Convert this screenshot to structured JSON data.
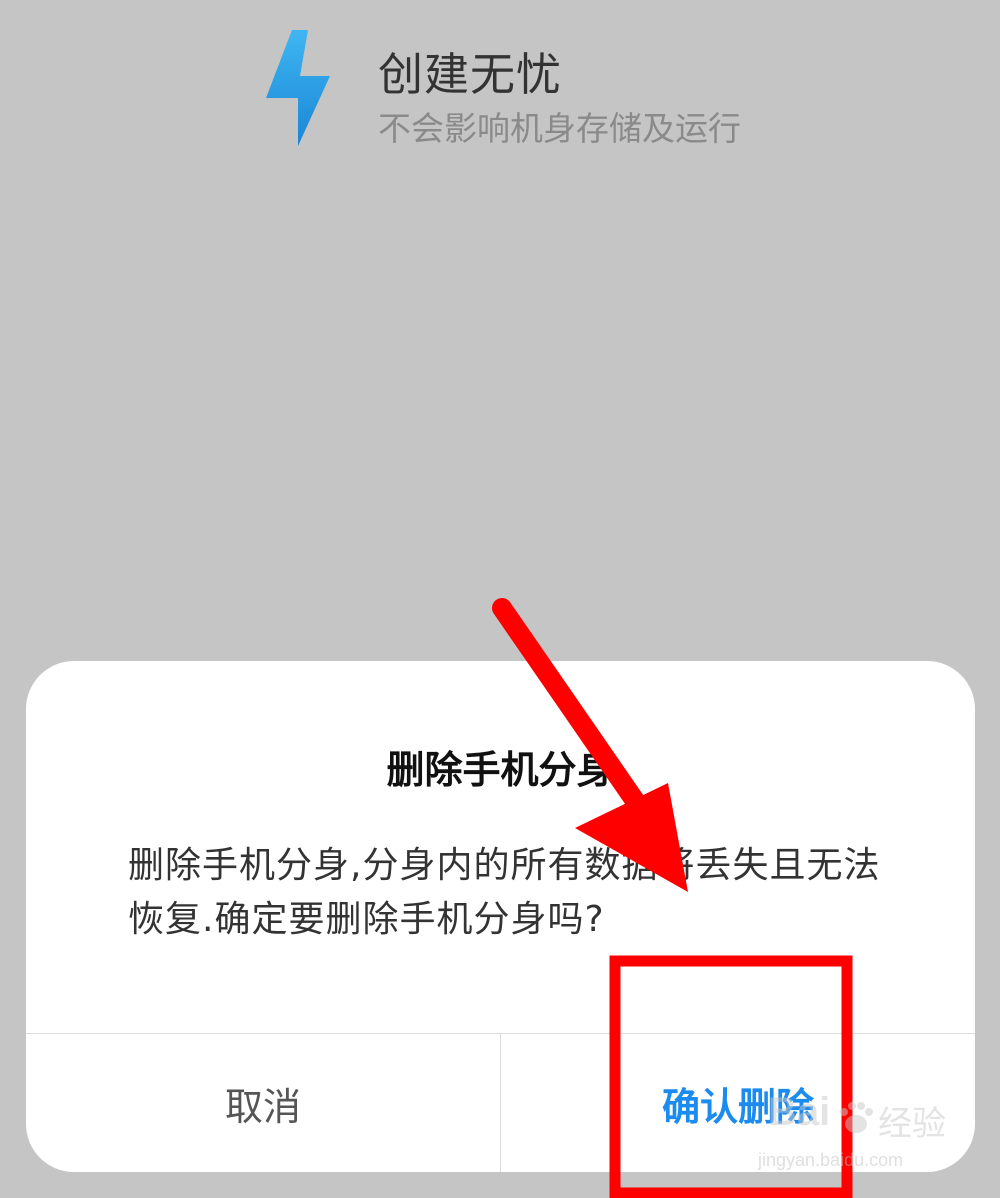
{
  "header": {
    "icon": "lightning-bolt-icon",
    "title": "创建无忧",
    "subtitle": "不会影响机身存储及运行"
  },
  "dialog": {
    "title": "删除手机分身",
    "message": "删除手机分身,分身内的所有数据将丢失且无法恢复.确定要删除手机分身吗?",
    "cancel_label": "取消",
    "confirm_label": "确认删除"
  },
  "watermark": {
    "logo": "Bai",
    "logo_icon": "paw-icon",
    "sub": "经验",
    "url": "jingyan.baidu.com"
  },
  "annotations": {
    "arrow_icon": "red-arrow-icon",
    "highlight": "red-highlight-box"
  },
  "colors": {
    "background": "#c5c5c5",
    "dialog_bg": "#ffffff",
    "accent": "#1c8bf0",
    "annotation": "#ff0000"
  }
}
